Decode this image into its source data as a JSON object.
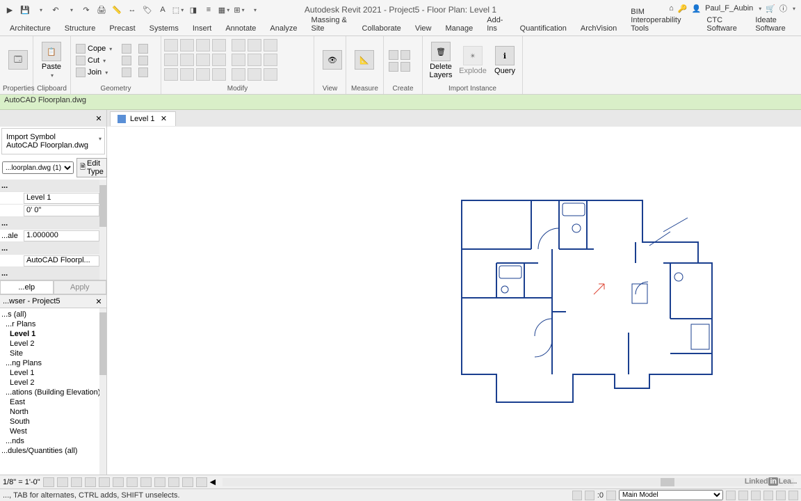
{
  "app": {
    "title": "Autodesk Revit 2021 - Project5 - Floor Plan: Level 1",
    "user": "Paul_F_Aubin"
  },
  "ribbon_tabs": [
    "Architecture",
    "Structure",
    "Precast",
    "Systems",
    "Insert",
    "Annotate",
    "Analyze",
    "Massing & Site",
    "Collaborate",
    "View",
    "Manage",
    "Add-Ins",
    "Quantification",
    "ArchVision",
    "BIM Interoperability Tools",
    "CTC Software",
    "Ideate Software"
  ],
  "panels": {
    "properties": "Properties",
    "clipboard": "Clipboard",
    "geometry": "Geometry",
    "modify": "Modify",
    "view": "View",
    "measure": "Measure",
    "create": "Create",
    "import_instance": "Import Instance"
  },
  "clipboard": {
    "paste": "Paste"
  },
  "geometry": {
    "cope": "Cope",
    "cut": "Cut",
    "join": "Join"
  },
  "import_instance": {
    "delete_layers": "Delete\nLayers",
    "explode": "Explode",
    "query": "Query"
  },
  "context": "AutoCAD Floorplan.dwg",
  "view_tab": {
    "label": "Level 1"
  },
  "properties_palette": {
    "type_category": "Import Symbol",
    "type_name": "AutoCAD Floorplan.dwg",
    "instance_sel": "...loorplan.dwg (1)",
    "edit_type": "Edit Type",
    "rows": {
      "base_level": "Level 1",
      "base_offset": "0'   0\"",
      "scale": "1.000000",
      "name": "AutoCAD Floorpl..."
    },
    "labels": {
      "scale": "...ale"
    },
    "help": "...elp",
    "apply": "Apply"
  },
  "browser": {
    "title": "...wser - Project5",
    "items": [
      {
        "t": "...s (all)",
        "lvl": 1
      },
      {
        "t": "...r Plans",
        "lvl": 2
      },
      {
        "t": "Level 1",
        "lvl": 3,
        "bold": true
      },
      {
        "t": "Level 2",
        "lvl": 3
      },
      {
        "t": "Site",
        "lvl": 3
      },
      {
        "t": "...ng Plans",
        "lvl": 2
      },
      {
        "t": "Level 1",
        "lvl": 3
      },
      {
        "t": "Level 2",
        "lvl": 3
      },
      {
        "t": "...ations (Building Elevation)",
        "lvl": 2
      },
      {
        "t": "East",
        "lvl": 3
      },
      {
        "t": "North",
        "lvl": 3
      },
      {
        "t": "South",
        "lvl": 3
      },
      {
        "t": "West",
        "lvl": 3
      },
      {
        "t": "...nds",
        "lvl": 2
      },
      {
        "t": "...dules/Quantities (all)",
        "lvl": 1
      }
    ]
  },
  "viewbar": {
    "scale": "1/8\" = 1'-0\""
  },
  "status": {
    "hint": "..., TAB for alternates, CTRL adds, SHIFT unselects.",
    "zero": ":0",
    "model": "Main Model"
  },
  "watermark": {
    "linked": "Linked",
    "in": "in",
    "lea": "Lea..."
  }
}
